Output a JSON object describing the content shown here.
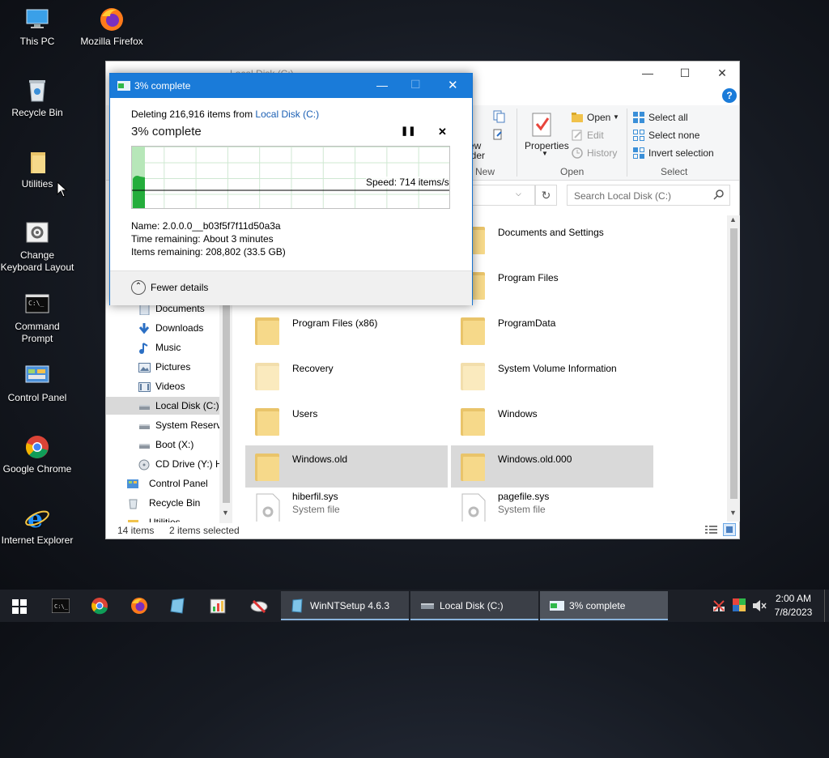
{
  "desktop": {
    "icons": [
      {
        "label": "This PC"
      },
      {
        "label": "Mozilla Firefox"
      },
      {
        "label": "Recycle Bin"
      },
      {
        "label": "Utilities"
      },
      {
        "label": "Change Keyboard Layout"
      },
      {
        "label": "Command Prompt"
      },
      {
        "label": "Control Panel"
      },
      {
        "label": "Google Chrome"
      },
      {
        "label": "Internet Explorer"
      }
    ]
  },
  "explorer": {
    "title": "Local Disk (C:)",
    "ribbon": {
      "new_partial": "ew",
      "folder_partial": "lder",
      "properties_label": "Properties",
      "open_label": "Open",
      "edit_label": "Edit",
      "history_label": "History",
      "select_all": "Select all",
      "select_none": "Select none",
      "invert_selection": "Invert selection",
      "group_new": "New",
      "group_open": "Open",
      "group_select": "Select"
    },
    "search_placeholder": "Search Local Disk (C:)",
    "nav_items": [
      {
        "label": "Documents"
      },
      {
        "label": "Downloads"
      },
      {
        "label": "Music"
      },
      {
        "label": "Pictures"
      },
      {
        "label": "Videos"
      },
      {
        "label": "Local Disk (C:)"
      },
      {
        "label": "System Reserve"
      },
      {
        "label": "Boot (X:)"
      },
      {
        "label": "CD Drive (Y:) H"
      },
      {
        "label": "Control Panel"
      },
      {
        "label": "Recycle Bin"
      },
      {
        "label": "Utilities"
      }
    ],
    "files": [
      {
        "name": "Documents and Settings"
      },
      {
        "name": "Program Files"
      },
      {
        "name": "Program Files (x86)"
      },
      {
        "name": "ProgramData"
      },
      {
        "name": "Recovery"
      },
      {
        "name": "System Volume Information"
      },
      {
        "name": "Users"
      },
      {
        "name": "Windows"
      },
      {
        "name": "Windows.old"
      },
      {
        "name": "Windows.old.000"
      },
      {
        "name": "hiberfil.sys",
        "sub": "System file"
      },
      {
        "name": "pagefile.sys",
        "sub": "System file"
      }
    ],
    "status_items": "14 items",
    "status_selected": "2 items selected"
  },
  "dialog": {
    "title": "3% complete",
    "deleting_prefix": "Deleting 216,916 items from",
    "deleting_target": "Local Disk (C:)",
    "heading": "3% complete",
    "speed": "Speed: 714 items/s",
    "progress_fraction": 0.03,
    "name_label": "Name:",
    "name_value": "2.0.0.0__b03f5f7f11d50a3a",
    "time_label": "Time remaining:",
    "time_value": "About 3 minutes",
    "items_label": "Items remaining:",
    "items_value": "208,802 (33.5 GB)",
    "fewer_details": "Fewer details"
  },
  "taskbar": {
    "btn_winnt": "WinNTSetup 4.6.3",
    "btn_localdisk": "Local Disk (C:)",
    "btn_progress": "3% complete",
    "time": "2:00 AM",
    "date": "7/8/2023"
  },
  "colors": {
    "accent": "#1a7bd9",
    "progress_green": "#2fb84a",
    "selected_bg": "#d9d9d9"
  }
}
